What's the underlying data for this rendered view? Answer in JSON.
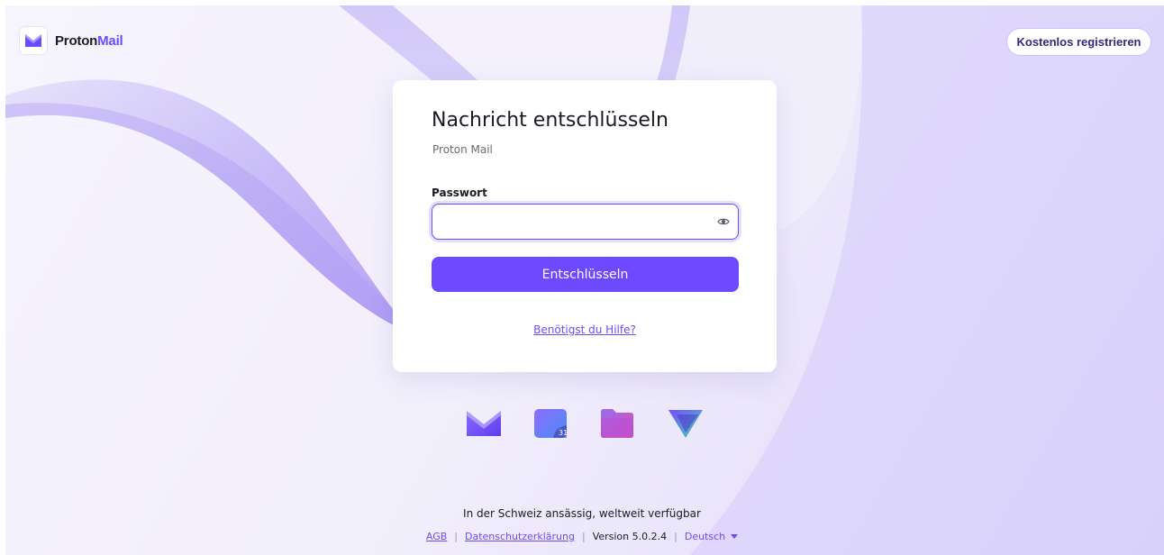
{
  "header": {
    "logo_word": "Proton",
    "logo_product": "Mail",
    "register_label": "Kostenlos registrieren"
  },
  "card": {
    "title": "Nachricht entschlüsseln",
    "subtitle": "Proton Mail",
    "password_label": "Passwort",
    "password_value": "",
    "submit_label": "Entschlüsseln",
    "help_link": "Benötigst du Hilfe?"
  },
  "apps": [
    {
      "icon": "proton-mail-icon"
    },
    {
      "icon": "proton-calendar-icon",
      "badge": "31"
    },
    {
      "icon": "proton-drive-icon"
    },
    {
      "icon": "proton-vpn-icon"
    }
  ],
  "footer": {
    "tagline": "In der Schweiz ansässig, weltweit verfügbar",
    "terms": "AGB",
    "privacy": "Datenschutzerklärung",
    "version": "Version 5.0.2.4",
    "language": "Deutsch"
  },
  "colors": {
    "accent": "#6d4aff",
    "text": "#1c1b24"
  }
}
